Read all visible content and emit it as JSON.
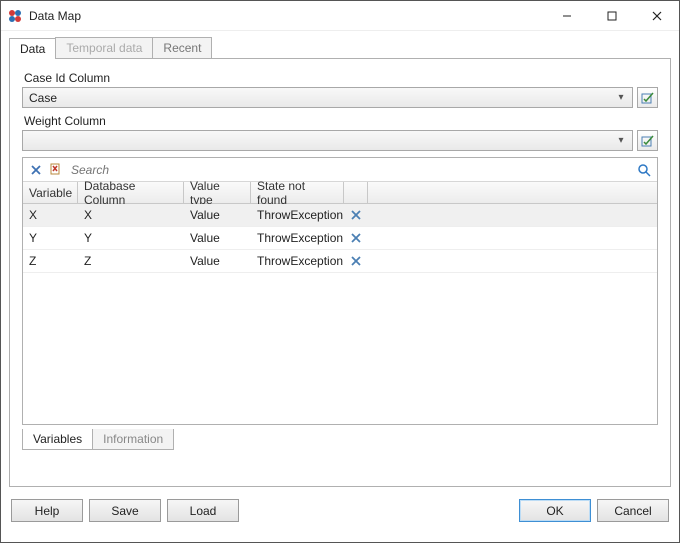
{
  "window": {
    "title": "Data Map"
  },
  "tabs": {
    "main": [
      {
        "label": "Data",
        "active": true,
        "disabled": false
      },
      {
        "label": "Temporal data",
        "active": false,
        "disabled": true
      },
      {
        "label": "Recent",
        "active": false,
        "disabled": false
      }
    ],
    "lower": [
      {
        "label": "Variables",
        "active": true
      },
      {
        "label": "Information",
        "active": false
      }
    ]
  },
  "fields": {
    "caseId": {
      "label": "Case Id Column",
      "value": "Case"
    },
    "weight": {
      "label": "Weight Column",
      "value": ""
    }
  },
  "grid": {
    "search_placeholder": "Search",
    "headers": {
      "variable": "Variable",
      "dbcol": "Database Column",
      "vtype": "Value type",
      "snf": "State not found"
    },
    "rows": [
      {
        "variable": "X",
        "dbcol": "X",
        "vtype": "Value",
        "snf": "ThrowException",
        "selected": true
      },
      {
        "variable": "Y",
        "dbcol": "Y",
        "vtype": "Value",
        "snf": "ThrowException",
        "selected": false
      },
      {
        "variable": "Z",
        "dbcol": "Z",
        "vtype": "Value",
        "snf": "ThrowException",
        "selected": false
      }
    ]
  },
  "buttons": {
    "help": "Help",
    "save": "Save",
    "load": "Load",
    "ok": "OK",
    "cancel": "Cancel"
  }
}
